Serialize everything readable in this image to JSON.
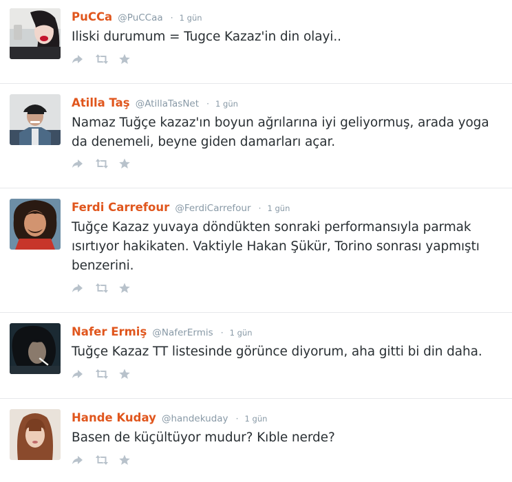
{
  "tweets": [
    {
      "name": "PuCCa",
      "handle": "@PuCCaa",
      "time": "1 gün",
      "text": "Iliski durumum = Tugce Kazaz'in din olayi..",
      "avatar": "avatar-woman-dark-hair"
    },
    {
      "name": "Atilla Taş",
      "handle": "@AtillaTasNet",
      "time": "1 gün",
      "text": "Namaz Tuğçe kazaz'ın boyun ağrılarına iyi geliyormuş, arada yoga da denemeli, beyne giden damarları açar.",
      "avatar": "avatar-man-cap"
    },
    {
      "name": "Ferdi Carrefour",
      "handle": "@FerdiCarrefour",
      "time": "1 gün",
      "text": "Tuğçe Kazaz yuvaya döndükten sonraki performansıyla parmak ısırtıyor hakikaten. Vaktiyle Hakan Şükür, Torino sonrası yapmıştı benzerini.",
      "avatar": "avatar-man-curly-hair"
    },
    {
      "name": "Nafer Ermiş",
      "handle": "@NaferErmis",
      "time": "1 gün",
      "text": "Tuğçe Kazaz TT listesinde görünce diyorum, aha gitti bi din daha.",
      "avatar": "avatar-man-cigarette"
    },
    {
      "name": "Hande Kuday",
      "handle": "@handekuday",
      "time": "1 gün",
      "text": "Basen de küçültüyor mudur? Kıble nerde?",
      "avatar": "avatar-woman-bangs"
    }
  ],
  "separator": "·",
  "icons": {
    "reply": "reply-icon",
    "retweet": "retweet-icon",
    "favorite": "star-icon"
  },
  "colors": {
    "name": "#e0561d",
    "meta": "#8899a6",
    "text": "#292f33",
    "icon": "#b8c2cb",
    "divider": "#e6e8ea"
  }
}
